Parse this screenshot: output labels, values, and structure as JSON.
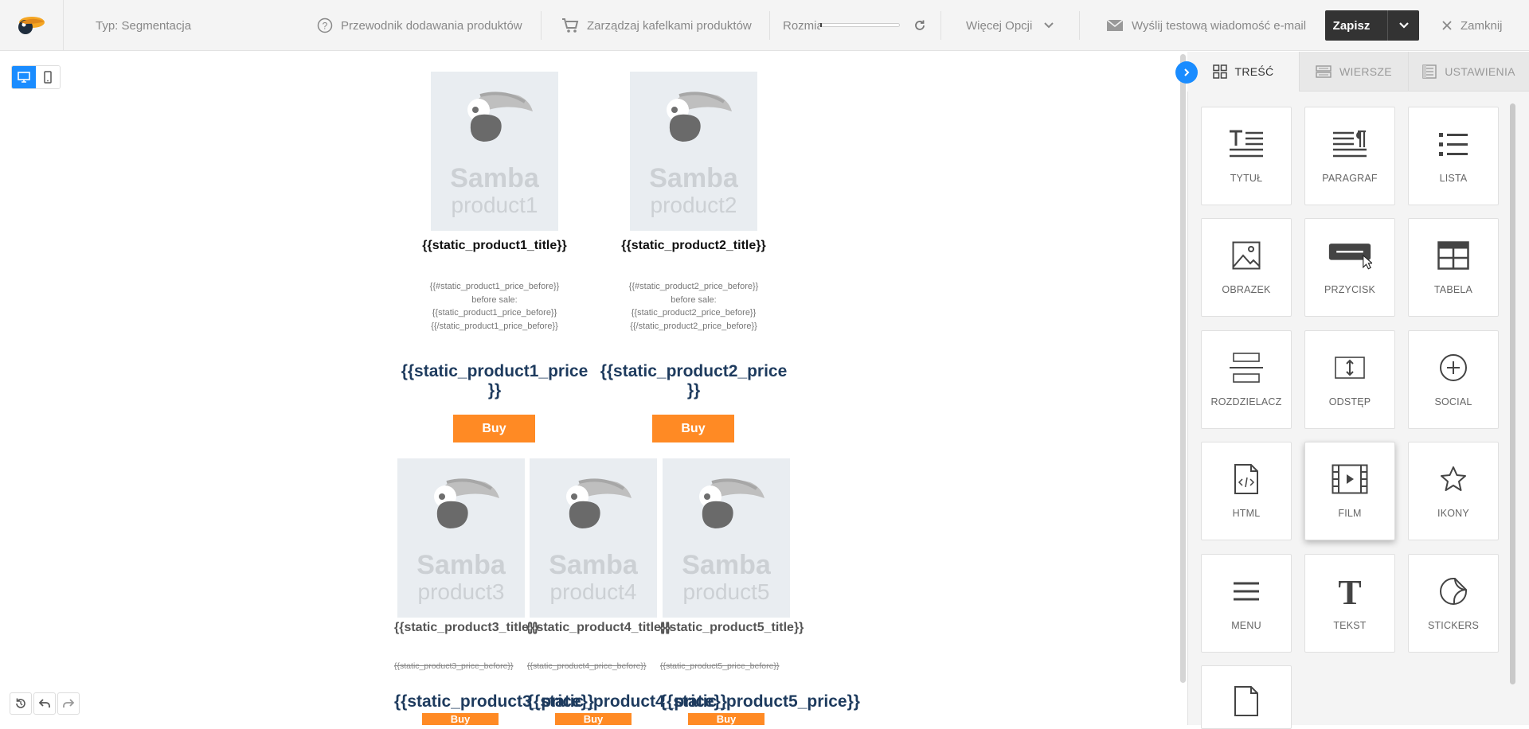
{
  "topbar": {
    "type_label": "Typ: Segmentacja",
    "guide_label": "Przewodnik dodawania produktów",
    "tiles_label": "Zarządzaj kafelkami produktów",
    "size_label": "Rozmiar",
    "more_label": "Więcej Opcji",
    "test_email_label": "Wyślij testową wiadomość e-mail",
    "save_label": "Zapisz",
    "close_label": "Zamknij"
  },
  "tabs": [
    {
      "label": "TREŚĆ",
      "icon": "grid-icon"
    },
    {
      "label": "WIERSZE",
      "icon": "rows-icon"
    },
    {
      "label": "USTAWIENIA",
      "icon": "settings-icon"
    }
  ],
  "tiles": [
    {
      "label": "TYTUŁ",
      "icon": "title-icon"
    },
    {
      "label": "PARAGRAF",
      "icon": "paragraph-icon"
    },
    {
      "label": "LISTA",
      "icon": "list-icon"
    },
    {
      "label": "OBRAZEK",
      "icon": "image-icon"
    },
    {
      "label": "PRZYCISK",
      "icon": "button-icon"
    },
    {
      "label": "TABELA",
      "icon": "table-icon"
    },
    {
      "label": "ROZDZIELACZ",
      "icon": "divider-icon"
    },
    {
      "label": "ODSTĘP",
      "icon": "spacer-icon"
    },
    {
      "label": "SOCIAL",
      "icon": "plus-circle-icon"
    },
    {
      "label": "HTML",
      "icon": "html-icon"
    },
    {
      "label": "FILM",
      "icon": "film-icon"
    },
    {
      "label": "IKONY",
      "icon": "star-icon"
    },
    {
      "label": "MENU",
      "icon": "menu-icon"
    },
    {
      "label": "TEKST",
      "icon": "text-icon"
    },
    {
      "label": "STICKERS",
      "icon": "sticker-icon"
    },
    {
      "label": "",
      "icon": "document-icon"
    }
  ],
  "email": {
    "samba_word": "Samba",
    "buy_label": "Buy",
    "products_row1": [
      {
        "name": "product1",
        "title": "{{static_product1_title}}",
        "before_lines": [
          "{{#static_product1_price_before}}",
          "before sale:",
          "{{static_product1_price_before}}",
          "{{/static_product1_price_before}}"
        ],
        "price_line1": "{{static_product1_price",
        "price_line2": "}}"
      },
      {
        "name": "product2",
        "title": "{{static_product2_title}}",
        "before_lines": [
          "{{#static_product2_price_before}}",
          "before sale:",
          "{{static_product2_price_before}}",
          "{{/static_product2_price_before}}"
        ],
        "price_line1": "{{static_product2_price",
        "price_line2": "}}"
      }
    ],
    "products_row2": [
      {
        "name": "product3",
        "title": "{{static_product3_title}}",
        "before": "{{static_product3_price_before}}",
        "price": "{{static_product3_price}}"
      },
      {
        "name": "product4",
        "title": "{{static_product4_title}}",
        "before": "{{static_product4_price_before}}",
        "price": "{{static_product4_price}}"
      },
      {
        "name": "product5",
        "title": "{{static_product5_title}}",
        "before": "{{static_product5_price_before}}",
        "price": "{{static_product5_price}}"
      }
    ]
  },
  "colors": {
    "accent": "#1a8cff",
    "buy_button": "#ff8a24",
    "price_text": "#1e3b5e",
    "save_button": "#333333"
  }
}
